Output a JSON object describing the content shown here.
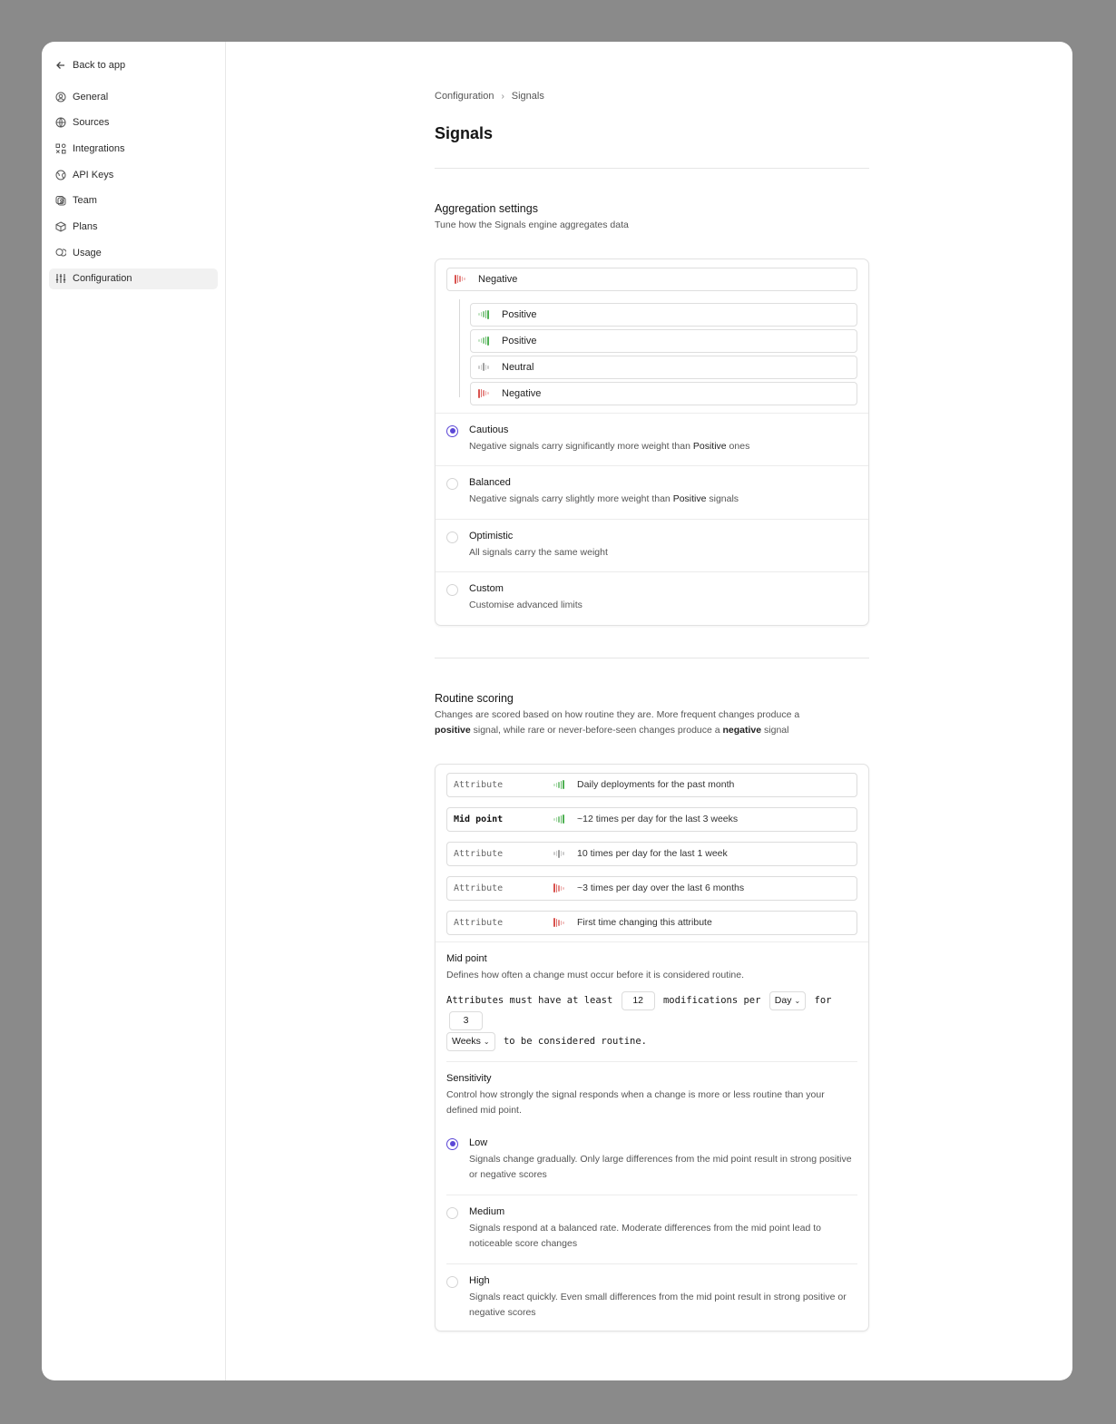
{
  "nav": {
    "back": "Back to app",
    "items": [
      {
        "label": "General",
        "icon": "user-circle-icon"
      },
      {
        "label": "Sources",
        "icon": "globe-icon"
      },
      {
        "label": "Integrations",
        "icon": "integrations-icon"
      },
      {
        "label": "API Keys",
        "icon": "api-globe-icon"
      },
      {
        "label": "Team",
        "icon": "team-icon"
      },
      {
        "label": "Plans",
        "icon": "box-icon"
      },
      {
        "label": "Usage",
        "icon": "coins-icon"
      },
      {
        "label": "Configuration",
        "icon": "sliders-icon",
        "active": true
      }
    ]
  },
  "breadcrumb": {
    "parent": "Configuration",
    "separator": "›",
    "current": "Signals"
  },
  "page_title": "Signals",
  "aggregation": {
    "title": "Aggregation settings",
    "description": "Tune how the Signals engine aggregates data",
    "root": "Negative",
    "children": [
      "Positive",
      "Positive",
      "Neutral",
      "Negative"
    ],
    "options": [
      {
        "label": "Cautious",
        "desc_pre": "Negative signals carry significantly more weight than ",
        "desc_bold": "Positive",
        "desc_post": " ones",
        "checked": true
      },
      {
        "label": "Balanced",
        "desc_pre": "Negative signals carry slightly more weight than ",
        "desc_bold": "Positive",
        "desc_post": " signals",
        "checked": false
      },
      {
        "label": "Optimistic",
        "desc_pre": "All signals carry the same weight",
        "desc_bold": "",
        "desc_post": "",
        "checked": false
      },
      {
        "label": "Custom",
        "desc_pre": "Customise advanced limits",
        "desc_bold": "",
        "desc_post": "",
        "checked": false
      }
    ]
  },
  "routine": {
    "title": "Routine scoring",
    "desc_1": "Changes are scored based on how routine they are. More frequent changes produce a ",
    "desc_bold_1": "positive",
    "desc_2": " signal, while rare or never-before-seen changes produce a ",
    "desc_bold_2": "negative",
    "desc_3": " signal",
    "attributes": [
      {
        "name": "Attribute",
        "text": "Daily deployments for the past month",
        "signal": "positive"
      },
      {
        "name": "Mid point",
        "text": "~12 times per day for the last 3 weeks",
        "signal": "positive"
      },
      {
        "name": "Attribute",
        "text": "10 times per day for the last 1 week",
        "signal": "neutral"
      },
      {
        "name": "Attribute",
        "text": "~3 times per day over the last 6 months",
        "signal": "negative"
      },
      {
        "name": "Attribute",
        "text": "First time changing this attribute",
        "signal": "negative"
      }
    ],
    "midpoint": {
      "title": "Mid point",
      "description": "Defines how often a change must occur before it is considered routine.",
      "sentence_1": "Attributes must have at least",
      "count": "12",
      "sentence_2": "modifications per",
      "period": "Day",
      "sentence_3": "for",
      "duration": "3",
      "unit": "Weeks",
      "sentence_4": "to be considered routine."
    },
    "sensitivity": {
      "title": "Sensitivity",
      "description": "Control how strongly the signal responds when a change is more or less routine than your defined mid point.",
      "options": [
        {
          "label": "Low",
          "desc": "Signals change gradually. Only large differences from the mid point result in strong positive or negative scores",
          "checked": true
        },
        {
          "label": "Medium",
          "desc": "Signals respond at a balanced rate. Moderate differences from the mid point lead to noticeable score changes",
          "checked": false
        },
        {
          "label": "High",
          "desc": "Signals react quickly. Even small differences from the mid point result in strong positive or negative scores",
          "checked": false
        }
      ]
    }
  },
  "colors": {
    "accent": "#5b47d6",
    "positive": "#4caf50",
    "negative": "#d9534f",
    "neutral": "#9a9a9a"
  }
}
